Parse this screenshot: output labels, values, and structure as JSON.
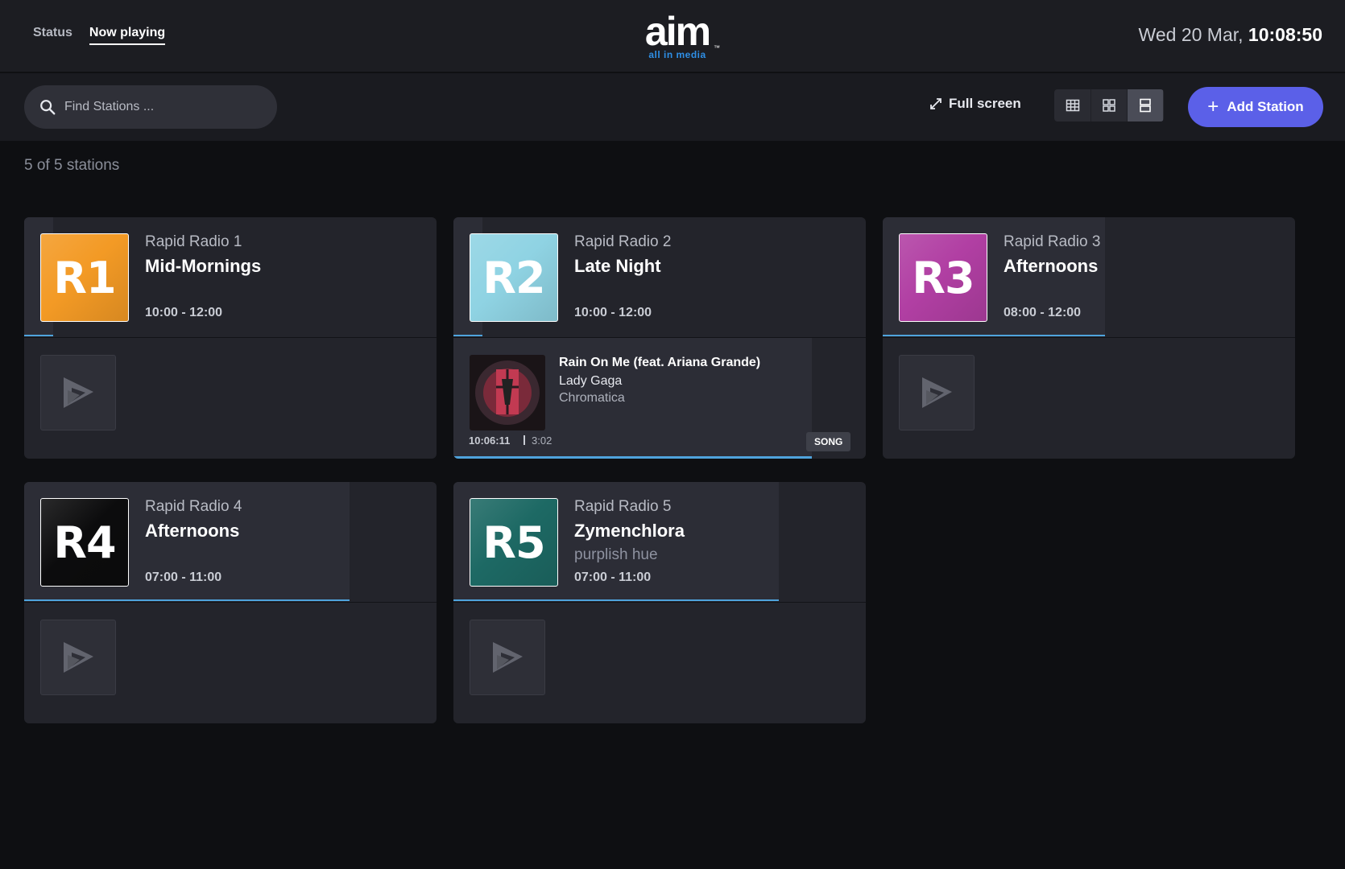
{
  "nav": {
    "status_label": "Status",
    "now_playing_label": "Now playing"
  },
  "logo": {
    "word": "aim",
    "tagline": "all in media",
    "tm": "™"
  },
  "clock": {
    "date": "Wed 20 Mar,",
    "time": "10:08:50"
  },
  "toolbar": {
    "search_placeholder": "Find Stations ...",
    "fullscreen_label": "Full screen",
    "view_modes": [
      "table",
      "grid",
      "list"
    ],
    "active_view": "list",
    "add_station_label": "Add Station",
    "accent_color": "#5b60e8"
  },
  "summary": {
    "count_text": "5 of 5 stations"
  },
  "stations": [
    {
      "badge": "R1",
      "badge_color": "#f39a25",
      "name": "Rapid Radio 1",
      "show": "Mid-Mornings",
      "subtitle": "",
      "time": "10:00 - 12:00",
      "show_progress": 0.07
    },
    {
      "badge": "R2",
      "badge_color": "#8fd3e3",
      "name": "Rapid Radio 2",
      "show": "Late Night",
      "subtitle": "",
      "time": "10:00 - 12:00",
      "show_progress": 0.07,
      "now_playing": {
        "title": "Rain On Me (feat. Ariana Grande)",
        "artist": "Lady Gaga",
        "album": "Chromatica",
        "start": "10:06:11",
        "duration": "3:02",
        "type": "SONG",
        "progress": 0.87
      }
    },
    {
      "badge": "R3",
      "badge_color": "#b13fa3",
      "name": "Rapid Radio 3",
      "show": "Afternoons",
      "subtitle": "",
      "time": "08:00 - 12:00",
      "show_progress": 0.54
    },
    {
      "badge": "R4",
      "badge_color": "#0c0c0d",
      "name": "Rapid Radio 4",
      "show": "Afternoons",
      "subtitle": "",
      "time": "07:00 - 11:00",
      "show_progress": 0.79
    },
    {
      "badge": "R5",
      "badge_color": "#1d6964",
      "name": "Rapid Radio 5",
      "show": "Zymenchlora",
      "subtitle": "purplish hue",
      "time": "07:00 - 11:00",
      "show_progress": 0.79
    }
  ]
}
